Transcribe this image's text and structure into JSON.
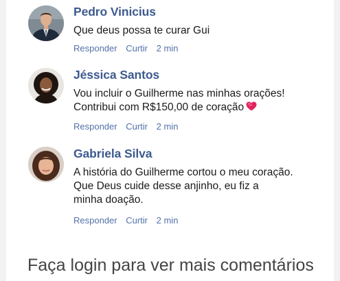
{
  "comments": [
    {
      "author": "Pedro Vinicius",
      "lines": [
        "Que deus possa te curar Gui"
      ],
      "actions": {
        "reply": "Responder",
        "like": "Curtir",
        "time": "2 min"
      }
    },
    {
      "author": "Jéssica Santos",
      "lines": [
        "Vou incluir o Guilherme nas minhas orações!",
        "Contribui com R$150,00 de coração"
      ],
      "actions": {
        "reply": "Responder",
        "like": "Curtir",
        "time": "2 min"
      }
    },
    {
      "author": "Gabriela Silva",
      "lines": [
        "A história do Guilherme cortou o meu coração.",
        "Que Deus cuide desse anjinho, eu fiz a",
        "minha doação."
      ],
      "actions": {
        "reply": "Responder",
        "like": "Curtir",
        "time": "2 min"
      }
    }
  ],
  "footer": {
    "login_prompt": "Faça login para ver mais comentários"
  },
  "colors": {
    "author": "#3d5a8f",
    "action_link": "#5271a8",
    "heart": "#e0245e",
    "page_bg": "#f2f2f2"
  },
  "icons": {
    "emoji_after_comment_2": "heart-icon"
  }
}
